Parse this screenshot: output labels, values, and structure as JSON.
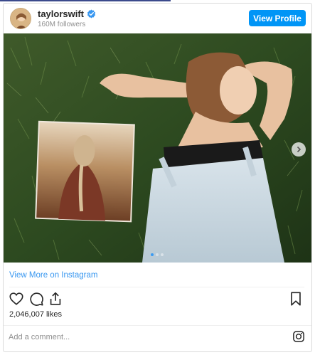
{
  "header": {
    "username": "taylorswift",
    "followers": "160M followers",
    "view_profile_label": "View Profile",
    "verified_icon": "verified-badge-icon"
  },
  "post": {
    "image_description_icon": "photo",
    "carousel_dots": 3,
    "active_dot": 0
  },
  "footer": {
    "view_more_label": "View More on Instagram",
    "likes": "2,046,007 likes",
    "comment_placeholder": "Add a comment..."
  },
  "icons": {
    "like": "heart-icon",
    "comment": "comment-icon",
    "share": "share-icon",
    "save": "bookmark-icon",
    "brand": "instagram-logo-icon",
    "next": "chevron-right-icon"
  },
  "colors": {
    "accent": "#0095f6",
    "link": "#3897f0",
    "muted": "#8e8e8e",
    "border": "#dbdbdb"
  }
}
